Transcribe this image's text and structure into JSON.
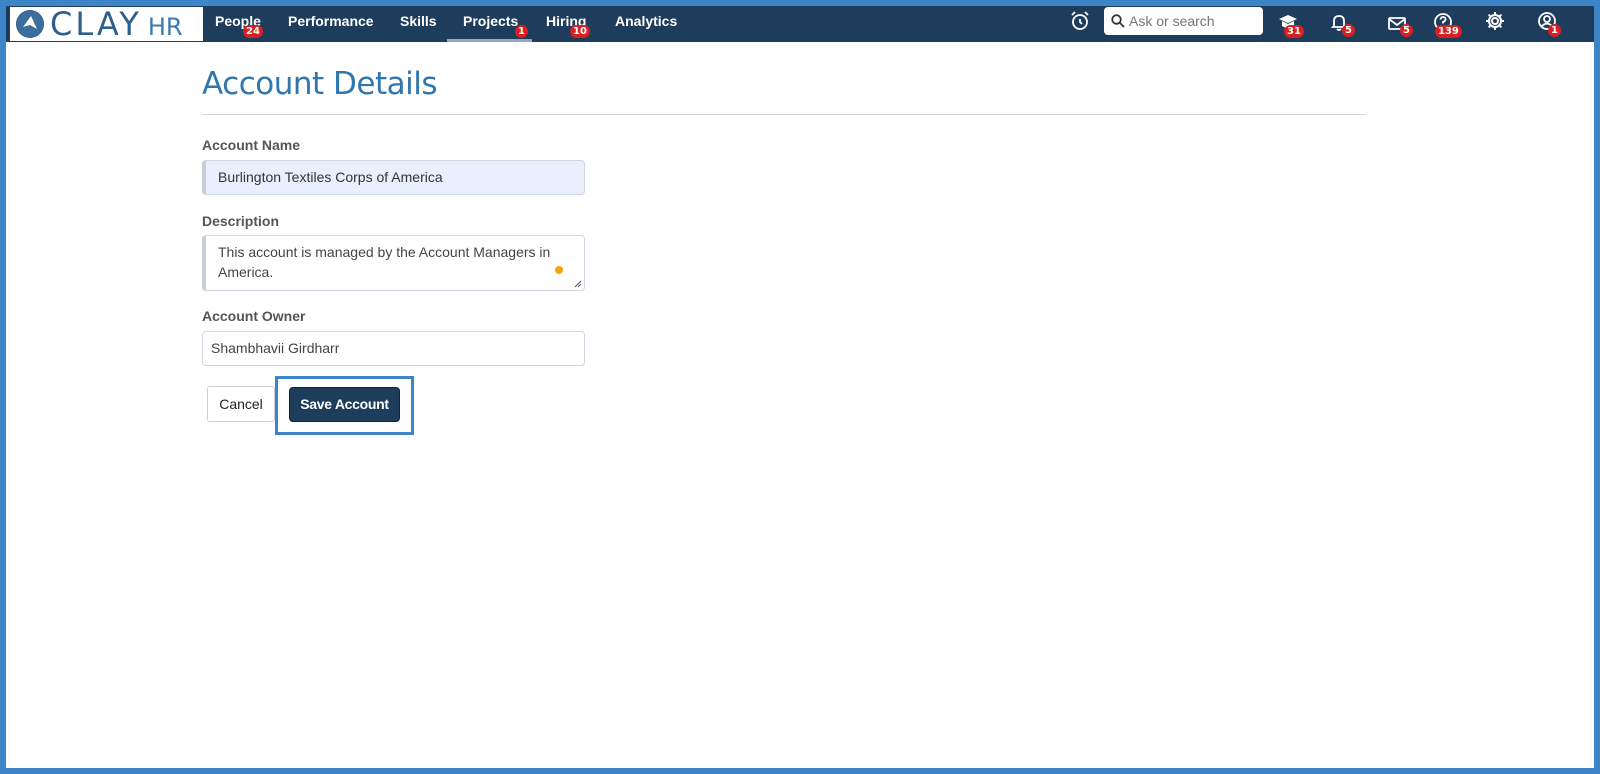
{
  "brand": {
    "name": "CLAY",
    "suffix": "HR"
  },
  "nav": {
    "items": [
      {
        "label": "People",
        "badge": "24"
      },
      {
        "label": "Performance",
        "badge": ""
      },
      {
        "label": "Skills",
        "badge": ""
      },
      {
        "label": "Projects",
        "badge": "1",
        "active": true
      },
      {
        "label": "Hiring",
        "badge": "10"
      },
      {
        "label": "Analytics",
        "badge": ""
      }
    ],
    "search_placeholder": "Ask or search",
    "icons": [
      {
        "name": "alarm-clock-icon",
        "badge": ""
      },
      {
        "name": "learning-cap-icon",
        "badge": "31"
      },
      {
        "name": "bell-icon",
        "badge": "5"
      },
      {
        "name": "mail-icon",
        "badge": "5"
      },
      {
        "name": "help-icon",
        "badge": "139"
      },
      {
        "name": "gear-icon",
        "badge": ""
      },
      {
        "name": "user-avatar-icon",
        "badge": "1"
      }
    ]
  },
  "form": {
    "title": "Account Details",
    "account_name_label": "Account Name",
    "account_name_value": "Burlington Textiles Corps of America",
    "description_label": "Description",
    "description_value": "This account is managed by the Account Managers in America.",
    "owner_label": "Account Owner",
    "owner_value": "Shambhavii Girdharr",
    "cancel_label": "Cancel",
    "save_label": "Save Account"
  },
  "colors": {
    "frame_border": "#3d85c6",
    "navbar": "#1e3d5c",
    "title": "#2f77ad",
    "badge": "#d92020",
    "save_button": "#1e3d5c"
  }
}
